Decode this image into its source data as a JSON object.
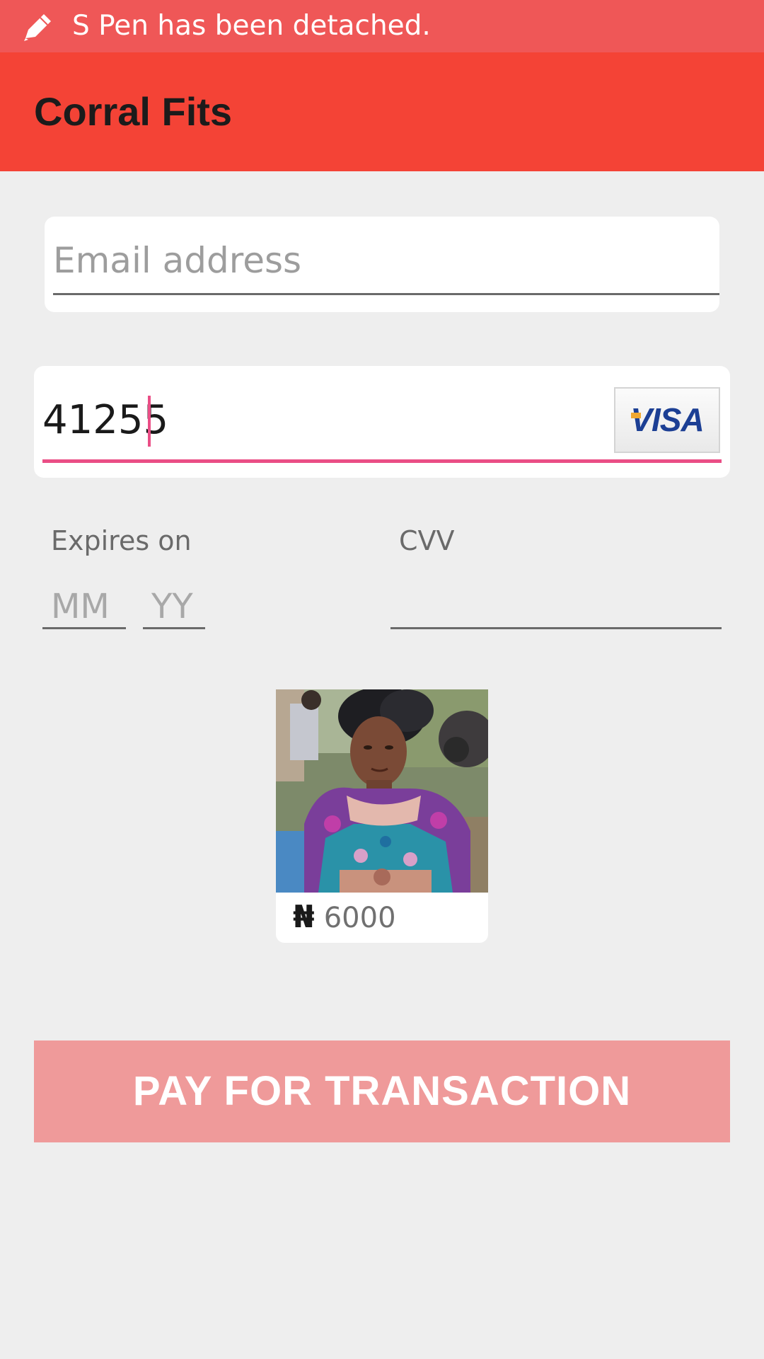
{
  "status_bar": {
    "icon": "pen-icon",
    "message": "S Pen has been detached."
  },
  "app_bar": {
    "title": "Corral Fits"
  },
  "form": {
    "email": {
      "placeholder": "Email address",
      "value": ""
    },
    "card_number": {
      "value": "41255",
      "brand_icon": "visa-logo",
      "brand_text": "VISA"
    },
    "expiry": {
      "label": "Expires on",
      "month_placeholder": "MM",
      "year_placeholder": "YY"
    },
    "cvv": {
      "label": "CVV",
      "value": ""
    }
  },
  "product": {
    "image": "product-photo-woman-in-ankara-dress",
    "currency_symbol": "₦",
    "price": "6000"
  },
  "actions": {
    "pay_label": "PAY FOR TRANSACTION"
  },
  "colors": {
    "status_bar": "#ef5757",
    "app_bar": "#f44336",
    "accent": "#ea4e86",
    "pay_button": "#ef9a9a",
    "background": "#eeeeee",
    "visa_blue": "#1c3f94"
  }
}
